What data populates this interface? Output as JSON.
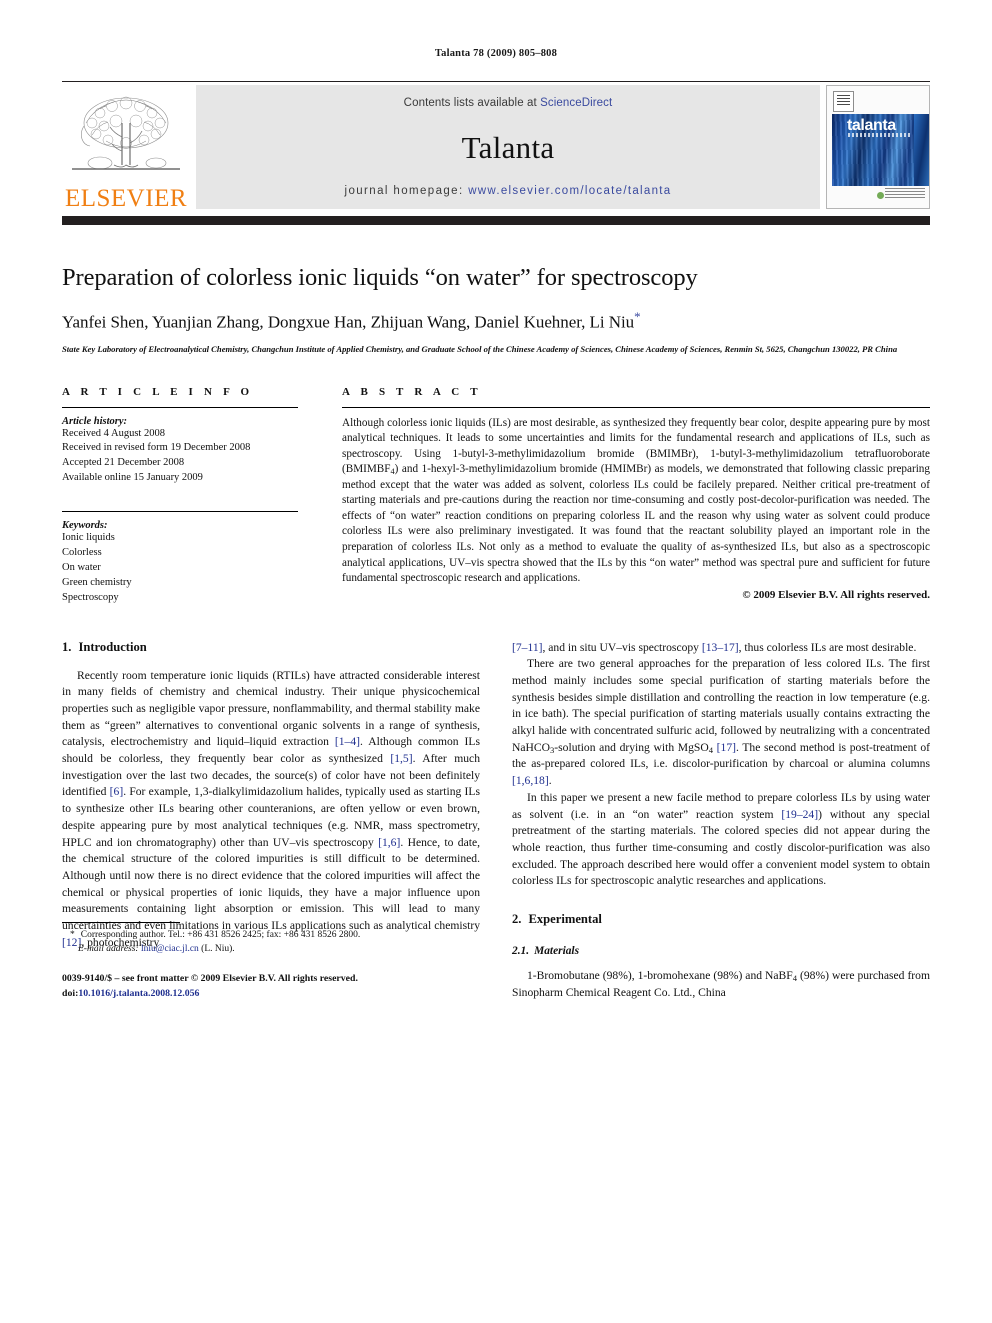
{
  "running_head": "Talanta 78 (2009) 805–808",
  "masthead": {
    "publisher_name": "ELSEVIER",
    "contents_prefix": "Contents lists available at ",
    "contents_link": "ScienceDirect",
    "journal_name": "Talanta",
    "homepage_prefix": "journal homepage: ",
    "homepage_url": "www.elsevier.com/locate/talanta",
    "cover_title": "talanta"
  },
  "title": "Preparation of colorless ionic liquids “on water” for spectroscopy",
  "authors": "Yanfei Shen, Yuanjian Zhang, Dongxue Han, Zhijuan Wang, Daniel Kuehner, Li Niu",
  "corresponding_marker": "*",
  "affiliation": "State Key Laboratory of Electroanalytical Chemistry, Changchun Institute of Applied Chemistry, and Graduate School of the Chinese Academy of Sciences, Chinese Academy of Sciences, Renmin St, 5625, Changchun 130022, PR China",
  "article_info": {
    "heading": "A R T I C L E  I N F O",
    "history_label": "Article history:",
    "history": [
      "Received 4 August 2008",
      "Received in revised form 19 December 2008",
      "Accepted 21 December 2008",
      "Available online 15 January 2009"
    ],
    "keywords_label": "Keywords:",
    "keywords": [
      "Ionic liquids",
      "Colorless",
      "On water",
      "Green chemistry",
      "Spectroscopy"
    ]
  },
  "abstract": {
    "heading": "A B S T R A C T",
    "text_part1": "Although colorless ionic liquids (ILs) are most desirable, as synthesized they frequently bear color, despite appearing pure by most analytical techniques. It leads to some uncertainties and limits for the fundamental research and applications of ILs, such as spectroscopy. Using 1-butyl-3-methylimidazolium bromide (BMIMBr), 1-butyl-3-methylimidazolium tetrafluoroborate (BMIMBF",
    "text_sub1": "4",
    "text_part2": ") and 1-hexyl-3-methylimidazolium bromide (HMIMBr) as models, we demonstrated that following classic preparing method except that the water was added as solvent, colorless ILs could be facilely prepared. Neither critical pre-treatment of starting materials and pre-cautions during the reaction nor time-consuming and costly post-decolor-purification was needed. The effects of “on water” reaction conditions on preparing colorless IL and the reason why using water as solvent could produce colorless ILs were also preliminary investigated. It was found that the reactant solubility played an important role in the preparation of colorless ILs. Not only as a method to evaluate the quality of as-synthesized ILs, but also as a spectroscopic analytical applications, UV–vis spectra showed that the ILs by this “on water” method was spectral pure and sufficient for future fundamental spectroscopic research and applications.",
    "copyright": "© 2009 Elsevier B.V. All rights reserved."
  },
  "sections": {
    "intro_num": "1.",
    "intro_title": "Introduction",
    "experimental_num": "2.",
    "experimental_title": "Experimental",
    "materials_num": "2.1.",
    "materials_title": "Materials"
  },
  "body": {
    "intro_p1_a": "Recently room temperature ionic liquids (RTILs) have attracted considerable interest in many fields of chemistry and chemical industry. Their unique physicochemical properties such as negligible vapor pressure, nonflammability, and thermal stability make them as “green” alternatives to conventional organic solvents in a range of synthesis, catalysis, electrochemistry and liquid–liquid extraction ",
    "ref_1_4": "[1–4]",
    "intro_p1_b": ". Although common ILs should be colorless, they frequently bear color as synthesized ",
    "ref_1_5": "[1,5]",
    "intro_p1_c": ". After much investigation over the last two decades, the source(s) of color have not been definitely identified ",
    "ref_6": "[6]",
    "intro_p1_d": ". For example, 1,3-dialkylimidazolium halides, typically used as starting ILs to synthesize other ILs bearing other counteranions, are often yellow or even brown, despite appearing pure by most analytical techniques (e.g. NMR, mass spectrometry, HPLC and ion chromatography) other than UV–vis spectroscopy ",
    "ref_1_6": "[1,6]",
    "intro_p1_e": ". Hence, to date, the chemical structure of the colored impurities is still difficult to be determined. Although until now there is no direct evidence that the colored impurities will affect the chemical or physical properties of ionic liquids, they have a major influence upon measurements containing light absorption or emission. This will lead to many uncertainties and even limitations in various ILs applications such as analytical chemistry ",
    "ref_12": "[12]",
    "intro_p1_f": ", photochemistry ",
    "ref_7_11": "[7–11]",
    "intro_p1_g": ", and in situ UV–vis spectroscopy ",
    "ref_13_17": "[13–17]",
    "intro_p1_h": ", thus colorless ILs are most desirable.",
    "intro_p2_a": "There are two general approaches for the preparation of less colored ILs. The first method mainly includes some special purification of starting materials before the synthesis besides simple distillation and controlling the reaction in low temperature (e.g. in ice bath). The special purification of starting materials usually contains extracting the alkyl halide with concentrated sulfuric acid, followed by neutralizing with a concentrated NaHCO",
    "sub_3": "3",
    "intro_p2_b": "-solution and drying with MgSO",
    "sub_4": "4",
    "intro_p2_c": " ",
    "ref_17": "[17]",
    "intro_p2_d": ". The second method is post-treatment of the as-prepared colored ILs, i.e. discolor-purification by charcoal or alumina columns ",
    "ref_1_6_18": "[1,6,18]",
    "intro_p2_e": ".",
    "intro_p3_a": "In this paper we present a new facile method to prepare colorless ILs by using water as solvent (i.e. in an “on water” reaction system ",
    "ref_19_24": "[19–24]",
    "intro_p3_b": ") without any special pretreatment of the starting materials. The colored species did not appear during the whole reaction, thus further time-consuming and costly discolor-purification was also excluded. The approach described here would offer a convenient model system to obtain colorless ILs for spectroscopic analytic researches and applications.",
    "materials_p_a": "1-Bromobutane (98%), 1-bromohexane (98%) and NaBF",
    "materials_sub": "4",
    "materials_p_b": " (98%) were purchased from Sinopharm Chemical Reagent Co. Ltd., China"
  },
  "footnotes": {
    "corr_star": "*",
    "corr_text": "Corresponding author. Tel.: +86 431 8526 2425; fax: +86 431 8526 2800.",
    "email_label": "E-mail address:",
    "email": "lniu@ciac.jl.cn",
    "email_suffix": " (L. Niu).",
    "issn_line": "0039-9140/$ – see front matter © 2009 Elsevier B.V. All rights reserved.",
    "doi_label": "doi:",
    "doi_value": "10.1016/j.talanta.2008.12.056"
  },
  "colors": {
    "link_blue": "#1f2f8f",
    "masthead_blue": "#3a4a9f",
    "elsevier_orange": "#f07f13",
    "rule_black": "#231f20",
    "band_gray": "#e6e6e6"
  }
}
